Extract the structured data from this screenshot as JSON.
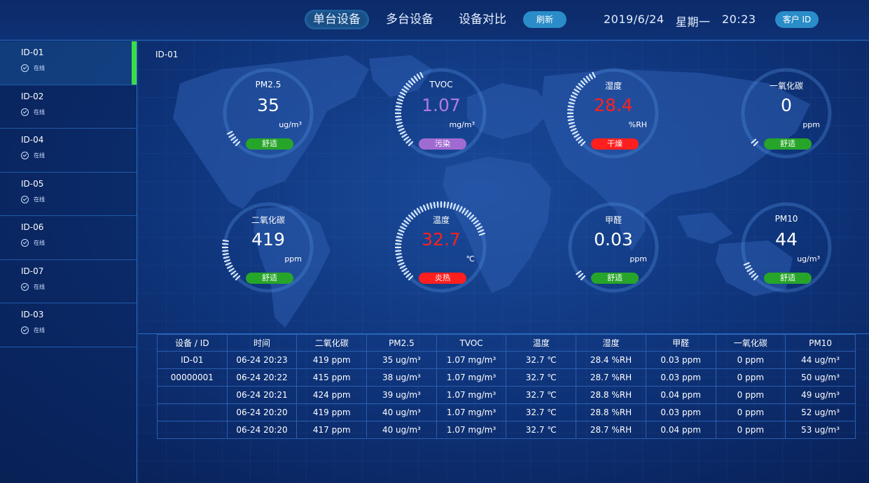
{
  "header": {
    "tabs": [
      {
        "label": "单台设备",
        "active": true
      },
      {
        "label": "多台设备",
        "active": false
      },
      {
        "label": "设备对比",
        "active": false
      }
    ],
    "refresh_label": "刷新",
    "date": "2019/6/24",
    "weekday": "星期一",
    "time": "20:23",
    "client_label": "客户 ID"
  },
  "sidebar": {
    "items": [
      {
        "id": "ID-01",
        "status": "在线",
        "active": true
      },
      {
        "id": "ID-02",
        "status": "在线",
        "active": false
      },
      {
        "id": "ID-04",
        "status": "在线",
        "active": false
      },
      {
        "id": "ID-05",
        "status": "在线",
        "active": false
      },
      {
        "id": "ID-06",
        "status": "在线",
        "active": false
      },
      {
        "id": "ID-07",
        "status": "在线",
        "active": false
      },
      {
        "id": "ID-03",
        "status": "在线",
        "active": false
      }
    ]
  },
  "device_title": "ID-01",
  "colors": {
    "good": "#27a52a",
    "polluted": "#a06bd0",
    "bad": "#ff1f1f",
    "value_red": "#ff2020",
    "value_purple": "#b27ae0",
    "accent": "#2a8cc8",
    "active_bar": "#3bdc4a"
  },
  "gauges": [
    {
      "label": "PM2.5",
      "value": "35",
      "unit": "ug/m³",
      "badge": "舒适",
      "level": 0.08,
      "state": "good"
    },
    {
      "label": "TVOC",
      "value": "1.07",
      "unit": "mg/m³",
      "badge": "污染",
      "level": 0.42,
      "state": "polluted"
    },
    {
      "label": "湿度",
      "value": "28.4",
      "unit": "%RH",
      "badge": "干燥",
      "level": 0.42,
      "state": "bad"
    },
    {
      "label": "一氧化碳",
      "value": "0",
      "unit": "ppm",
      "badge": "舒适",
      "level": 0.03,
      "state": "good"
    },
    {
      "label": "二氧化碳",
      "value": "419",
      "unit": "ppm",
      "badge": "舒适",
      "level": 0.22,
      "state": "good"
    },
    {
      "label": "温度",
      "value": "32.7",
      "unit": "℃",
      "badge": "炎热",
      "level": 0.78,
      "state": "bad"
    },
    {
      "label": "甲醛",
      "value": "0.03",
      "unit": "ppm",
      "badge": "舒适",
      "level": 0.05,
      "state": "good"
    },
    {
      "label": "PM10",
      "value": "44",
      "unit": "ug/m³",
      "badge": "舒适",
      "level": 0.1,
      "state": "good"
    }
  ],
  "table": {
    "headers": [
      "设备 / ID",
      "时间",
      "二氧化碳",
      "PM2.5",
      "TVOC",
      "温度",
      "湿度",
      "甲醛",
      "一氧化碳",
      "PM10"
    ],
    "rows": [
      [
        "ID-01",
        "06-24 20:23",
        "419 ppm",
        "35 ug/m³",
        "1.07 mg/m³",
        "32.7 ℃",
        "28.4 %RH",
        "0.03 ppm",
        "0 ppm",
        "44 ug/m³"
      ],
      [
        "00000001",
        "06-24 20:22",
        "415 ppm",
        "38 ug/m³",
        "1.07 mg/m³",
        "32.7 ℃",
        "28.7 %RH",
        "0.03 ppm",
        "0 ppm",
        "50 ug/m³"
      ],
      [
        "",
        "06-24 20:21",
        "424 ppm",
        "39 ug/m³",
        "1.07 mg/m³",
        "32.7 ℃",
        "28.8 %RH",
        "0.04 ppm",
        "0 ppm",
        "49 ug/m³"
      ],
      [
        "",
        "06-24 20:20",
        "419 ppm",
        "40 ug/m³",
        "1.07 mg/m³",
        "32.7 ℃",
        "28.8 %RH",
        "0.03 ppm",
        "0 ppm",
        "52 ug/m³"
      ],
      [
        "",
        "06-24 20:20",
        "417 ppm",
        "40 ug/m³",
        "1.07 mg/m³",
        "32.7 ℃",
        "28.7 %RH",
        "0.04 ppm",
        "0 ppm",
        "53 ug/m³"
      ]
    ]
  }
}
